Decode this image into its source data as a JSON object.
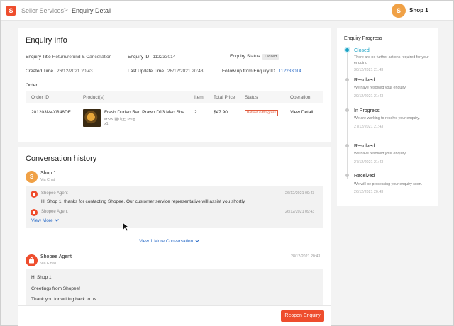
{
  "header": {
    "logo_letter": "S",
    "breadcrumb": [
      "Seller Services",
      "Enquiry Detail"
    ],
    "separator": ">",
    "user": {
      "initial": "S",
      "name": "Shop 1"
    }
  },
  "enquiry_info": {
    "title": "Enquiry Info",
    "fields": {
      "enquiry_title_label": "Enquiry Title",
      "enquiry_title_value": "Return/refund & Cancellation",
      "enquiry_id_label": "Enquiry ID",
      "enquiry_id_value": "112233014",
      "enquiry_status_label": "Enquiry Status",
      "enquiry_status_value": "Closed",
      "created_time_label": "Created Time",
      "created_time_value": "26/12/2021 20:43",
      "last_update_label": "Last Update Time",
      "last_update_value": "28/12/2021 20:43",
      "followup_label": "Follow up from Enquiry ID",
      "followup_value": "112233014"
    },
    "order_label": "Order",
    "table": {
      "headers": [
        "Order ID",
        "Product(s)",
        "Item",
        "Total Price",
        "Status",
        "Operation"
      ],
      "row": {
        "order_id": "201203M4XR48DF",
        "product_name": "Fresh Durian Red Prawn D13 Mao Sha ...",
        "product_variant": "MSW 猫山王 350g",
        "product_qty": "x1",
        "item": "2",
        "total_price": "$47.90",
        "status": "Refund in Progress",
        "operation": "View Detail"
      }
    }
  },
  "progress": {
    "title": "Enquiry Progress",
    "steps": [
      {
        "title": "Closed",
        "desc": "There are no further actions required for your enquiry.",
        "time": "30/12/2021 21:43",
        "active": true
      },
      {
        "title": "Resolved",
        "desc": "We have resolved your enquiry.",
        "time": "29/12/2021 21:43",
        "active": false
      },
      {
        "title": "In Progress",
        "desc": "We are working to resolve your enquiry.",
        "time": "27/12/2021 21:43",
        "active": false
      },
      {
        "title": "Resolved",
        "desc": "We have resolved your enquiry.",
        "time": "27/12/2021 21:43",
        "active": false
      },
      {
        "title": "Received",
        "desc": "We will be processing your enquiry soon.",
        "time": "26/12/2021 20:43",
        "active": false
      }
    ]
  },
  "conversation": {
    "title": "Conversation history",
    "thread1": {
      "avatar_initial": "S",
      "name": "Shop 1",
      "via": "Via Chat",
      "messages": [
        {
          "sender": "Shopee Agent",
          "time": "26/12/2021 09:43",
          "text": "Hi Shop 1, thanks for contacting Shopee. Our customer service representative will assist you shortly"
        },
        {
          "sender": "Shopee Agent",
          "time": "26/12/2021 09:43"
        }
      ],
      "view_more": "View More"
    },
    "more_link": "View 1 More Conversation",
    "thread2": {
      "name": "Shopee Agent",
      "via": "Via Email",
      "time": "28/12/2021 20:43",
      "lines": [
        "Hi Shop 1,",
        "Greetings from Shopee!",
        "Thank you for writing back to us."
      ]
    }
  },
  "footer": {
    "reopen_label": "Reopen Enquiry"
  },
  "colors": {
    "brand": "#ee4d2d",
    "link": "#2e6ec8",
    "active_step": "#1aa2c4"
  }
}
